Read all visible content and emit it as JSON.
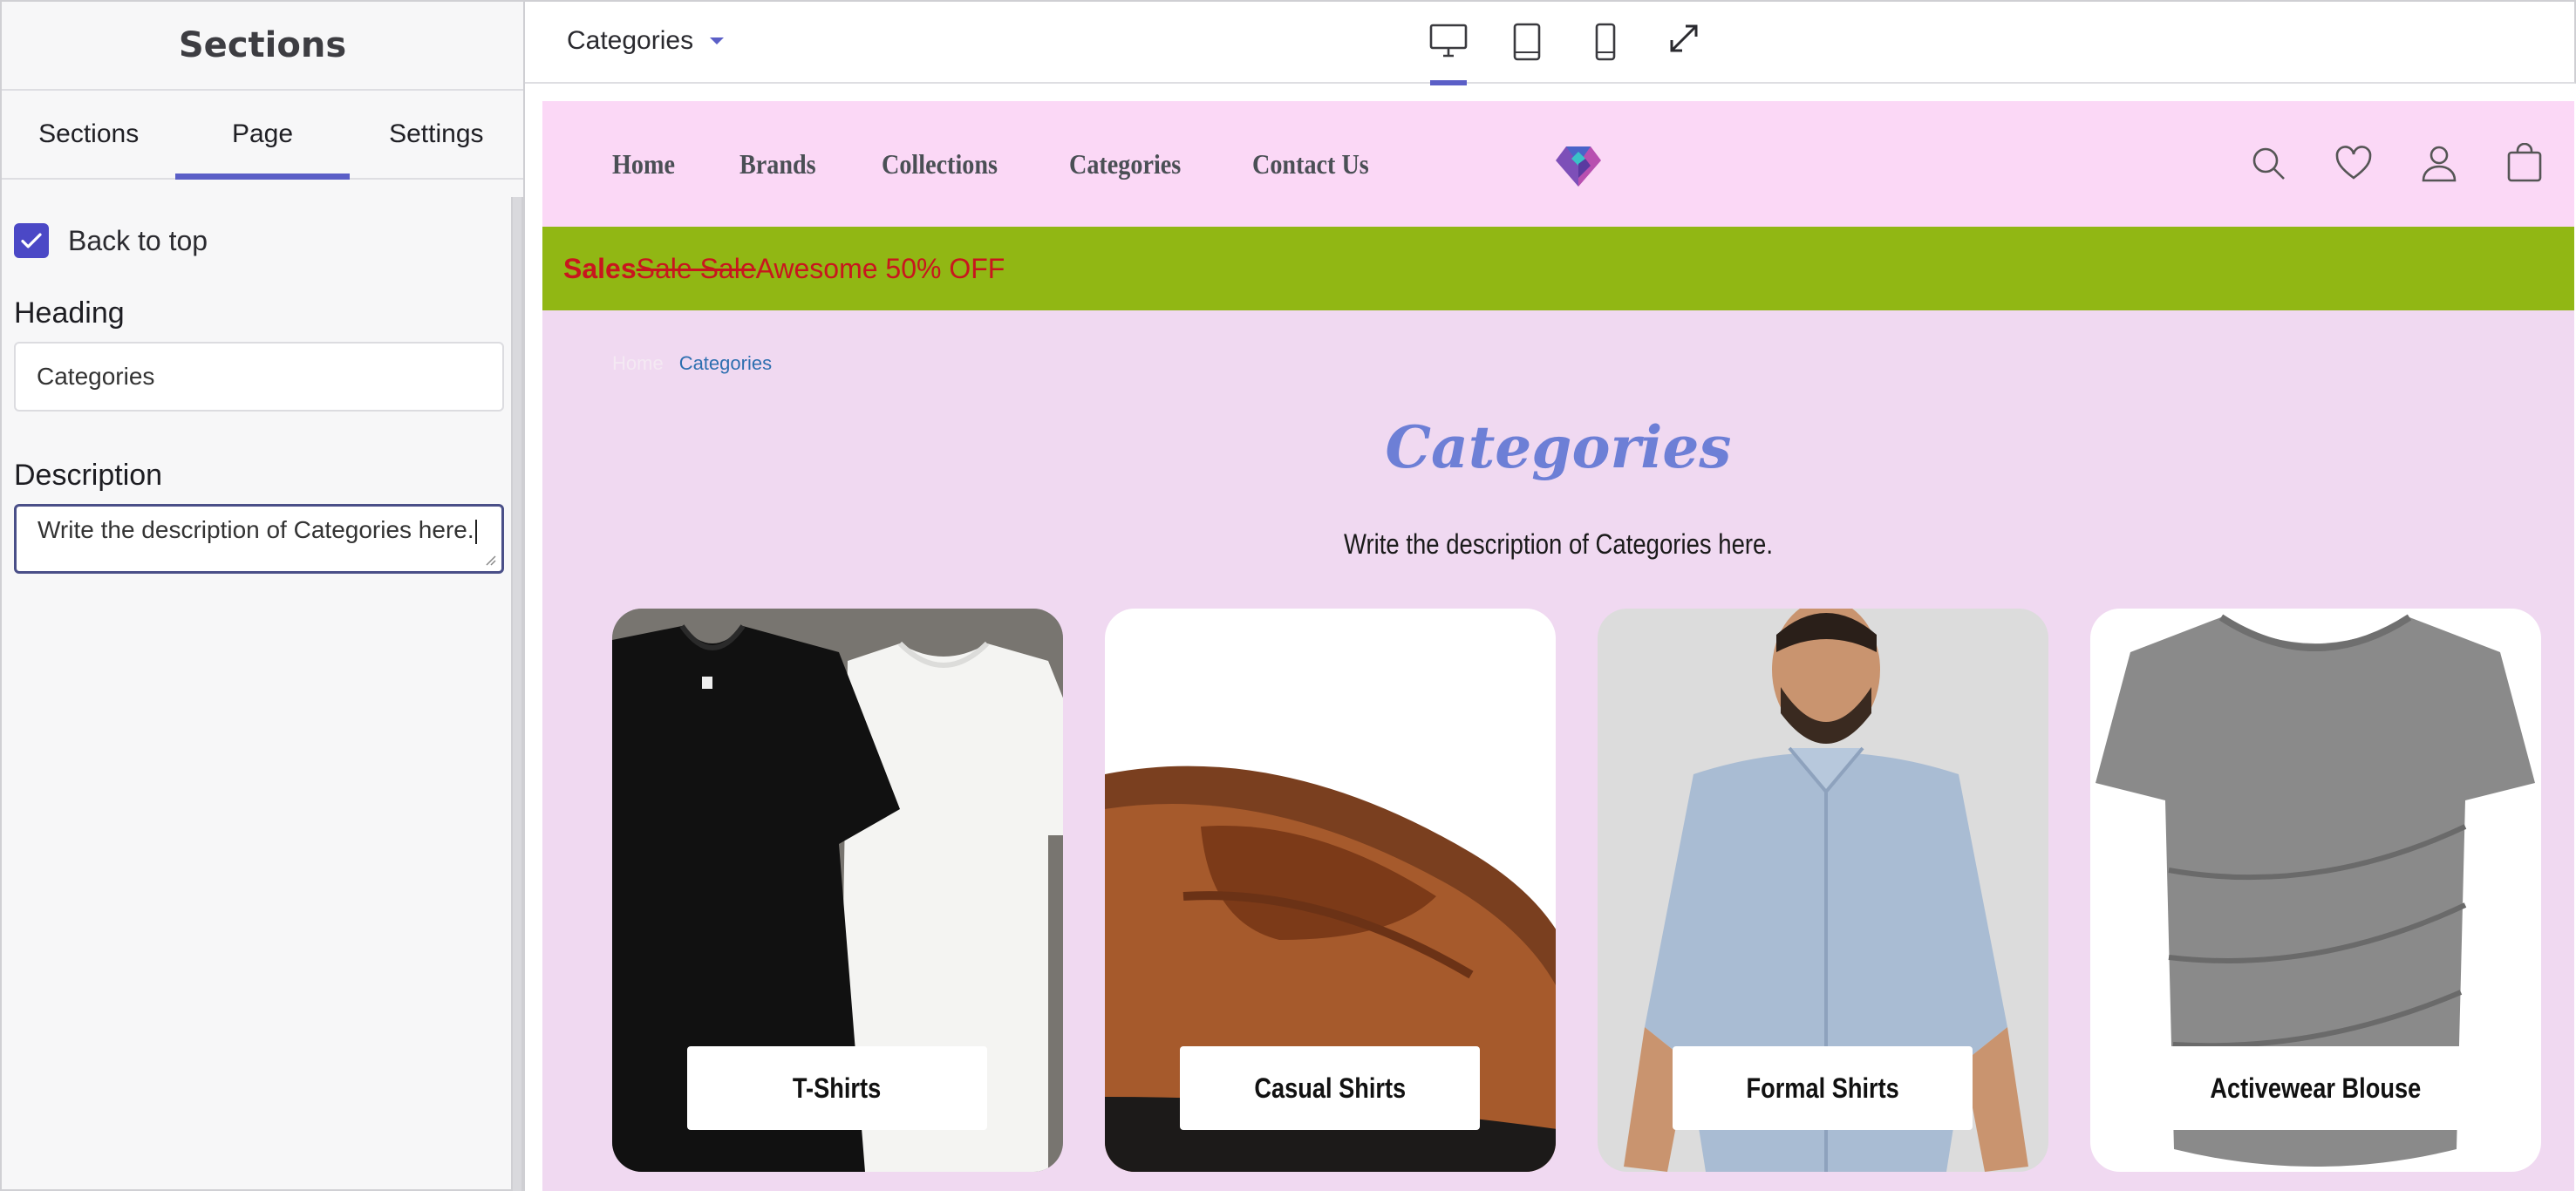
{
  "sidebar": {
    "title": "Sections",
    "tabs": [
      {
        "label": "Sections",
        "active": false
      },
      {
        "label": "Page",
        "active": true
      },
      {
        "label": "Settings",
        "active": false
      }
    ],
    "back_to_top": {
      "label": "Back to top",
      "checked": true
    },
    "heading": {
      "label": "Heading",
      "value": "Categories"
    },
    "description": {
      "label": "Description",
      "value": "Write the description of Categories here."
    }
  },
  "toolbar": {
    "page_selector": "Categories",
    "devices": [
      "desktop-icon",
      "tablet-icon",
      "mobile-icon",
      "fullscreen-icon"
    ],
    "active_device": "desktop"
  },
  "store": {
    "nav": [
      "Home",
      "Brands",
      "Collections",
      "Categories",
      "Contact Us"
    ],
    "nav_icons": [
      "search-icon",
      "heart-icon",
      "user-icon",
      "bag-icon"
    ],
    "promo": {
      "bold": "Sales",
      "strike": "Sale Sale",
      "text": "Awesome 50% OFF"
    },
    "breadcrumb": [
      "Home",
      "Categories"
    ],
    "title": "Categories",
    "description": "Write the description of Categories here.",
    "categories": [
      "T-Shirts",
      "Casual Shirts",
      "Formal Shirts",
      "Activewear Blouse"
    ]
  },
  "colors": {
    "accent": "#5b5fc7",
    "nav_bg": "#fbd8f6",
    "promo_bg": "#91b714",
    "promo_text": "#c8161e",
    "page_bg": "#f0d9f1",
    "title": "#6d7fd6"
  }
}
